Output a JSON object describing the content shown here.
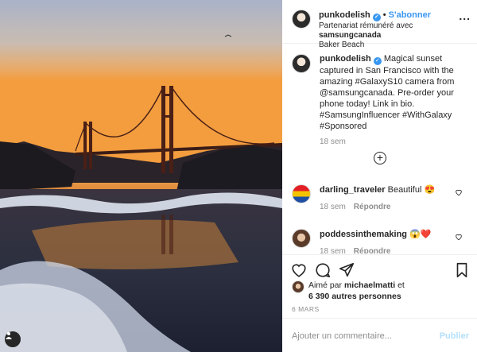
{
  "post": {
    "photo_alt": "Golden Gate Bridge at sunset from Baker Beach",
    "header": {
      "username": "punkodelish",
      "verified_mark": "✓",
      "dot": "•",
      "follow_label": "S'abonner",
      "partnership_prefix": "Partenariat rémunéré avec",
      "partner": "samsungcanada",
      "location": "Baker Beach",
      "more": "..."
    },
    "caption": {
      "username": "punkodelish",
      "text": "Magical sunset captured in San Francisco with the amazing #GalaxyS10 camera from @samsungcanada. Pre-order your phone today! Link in bio. #SamsungInfluencer #WithGalaxy #Sponsored",
      "time": "18 sem",
      "load_more": "+"
    },
    "comments": [
      {
        "username": "darling_traveler",
        "text": "Beautiful 😍",
        "time": "18 sem",
        "reply_label": "Répondre"
      },
      {
        "username": "poddessinthemaking",
        "text": "😱❤️",
        "time": "18 sem",
        "reply_label": "Répondre"
      }
    ],
    "likes": {
      "prefix": "Aimé par",
      "user": "michaelmatti",
      "conj": "et",
      "others": "6 390 autres personnes"
    },
    "date": "6 MARS",
    "add_comment": {
      "placeholder": "Ajouter un commentaire...",
      "post_label": "Publier"
    },
    "icons": {
      "like": "heart-icon",
      "comment": "comment-icon",
      "share": "share-icon",
      "save": "bookmark-icon",
      "tag": "user-tag-icon"
    }
  }
}
